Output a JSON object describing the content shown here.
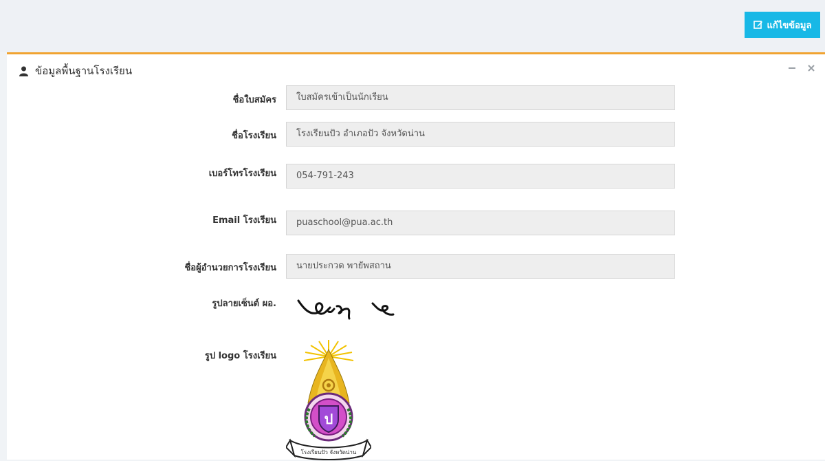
{
  "toolbar": {
    "edit_label": "แก้ไขข้อมูล"
  },
  "panel": {
    "title": "ข้อมูลพื้นฐานโรงเรียน",
    "fields": [
      {
        "label": "ชื่อใบสมัคร",
        "value": "ใบสมัครเข้าเป็นนักเรียน"
      },
      {
        "label": "ชื่อโรงเรียน",
        "value": "โรงเรียนปัว อำเภอปัว จังหวัดน่าน"
      },
      {
        "label": "เบอร์โทรโรงเรียน",
        "value": "054-791-243"
      },
      {
        "label": "Email โรงเรียน",
        "value": "puaschool@pua.ac.th"
      },
      {
        "label": "ชื่อผู้อำนวยการโรงเรียน",
        "value": "นายประกวด พายัพสถาน"
      }
    ],
    "signature_label": "รูปลายเซ็นต์ ผอ.",
    "logo_label": "รูป logo โรงเรียน",
    "logo_text": "โรงเรียนปัว จังหวัดน่าน",
    "logo_emblem_letter": "ป"
  },
  "colors": {
    "accent_orange": "#f0a330",
    "edit_button": "#17b8e6"
  }
}
